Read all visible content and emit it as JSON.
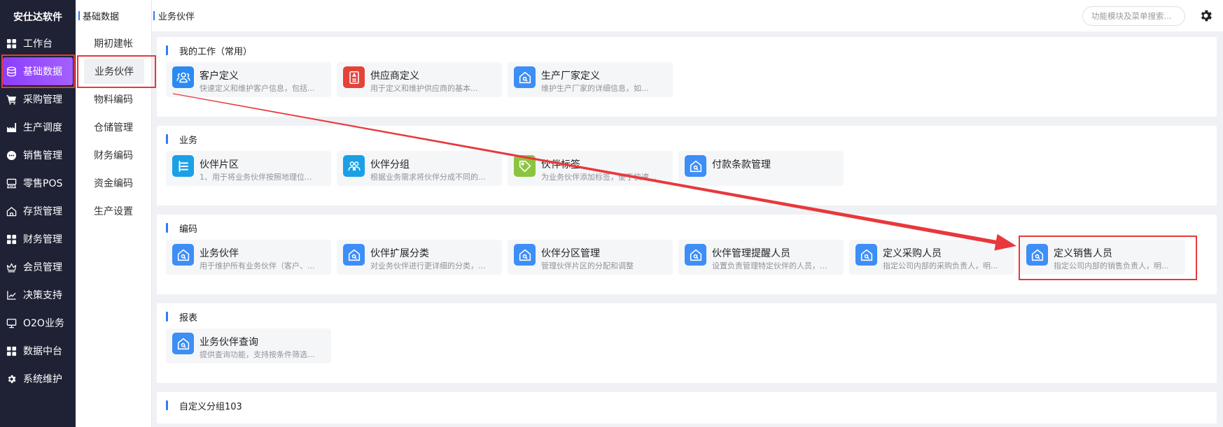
{
  "app": {
    "title": "安仕达软件"
  },
  "sidebar": {
    "items": [
      {
        "label": "工作台",
        "icon": "grid-icon"
      },
      {
        "label": "基础数据",
        "icon": "database-icon",
        "active": true
      },
      {
        "label": "采购管理",
        "icon": "cart-icon"
      },
      {
        "label": "生产调度",
        "icon": "factory-icon"
      },
      {
        "label": "销售管理",
        "icon": "chat-dots-icon"
      },
      {
        "label": "零售POS",
        "icon": "register-icon"
      },
      {
        "label": "存货管理",
        "icon": "warehouse-icon"
      },
      {
        "label": "财务管理",
        "icon": "grid-icon"
      },
      {
        "label": "会员管理",
        "icon": "crown-icon"
      },
      {
        "label": "决策支持",
        "icon": "chart-line-icon"
      },
      {
        "label": "O2O业务",
        "icon": "monitor-icon"
      },
      {
        "label": "数据中台",
        "icon": "grid-icon"
      },
      {
        "label": "系统维护",
        "icon": "gear-icon"
      }
    ]
  },
  "subnav": {
    "title": "基础数据",
    "items": [
      {
        "label": "期初建帐"
      },
      {
        "label": "业务伙伴",
        "active": true
      },
      {
        "label": "物料编码"
      },
      {
        "label": "仓储管理"
      },
      {
        "label": "财务编码"
      },
      {
        "label": "资金编码"
      },
      {
        "label": "生产设置"
      }
    ]
  },
  "header": {
    "breadcrumb": "业务伙伴",
    "search_placeholder": "功能模块及菜单搜索...",
    "settings_icon": "gear-icon"
  },
  "main": {
    "sections": [
      {
        "title": "我的工作（常用）",
        "cards": [
          {
            "title": "客户定义",
            "desc": "快速定义和维护客户信息，包括...",
            "icon": "customer-icon",
            "color": "#2b8af2"
          },
          {
            "title": "供应商定义",
            "desc": "用于定义和维护供应商的基本...",
            "icon": "supplier-icon",
            "color": "#e5433a"
          },
          {
            "title": "生产厂家定义",
            "desc": "维护生产厂家的详细信息，如...",
            "icon": "house-search-icon",
            "color": "#3d8ef6"
          }
        ]
      },
      {
        "title": "业务",
        "cards": [
          {
            "title": "伙伴片区",
            "desc": "1、用于将业务伙伴按照地理位...",
            "icon": "tree-icon",
            "color": "#1aa0e6"
          },
          {
            "title": "伙伴分组",
            "desc": "根据业务需求将伙伴分成不同的...",
            "icon": "group-icon",
            "color": "#1aa0e6"
          },
          {
            "title": "伙伴标签",
            "desc": "为业务伙伴添加标签，便于快速...",
            "icon": "tag-icon",
            "color": "#8bc53f"
          },
          {
            "title": "付款条款管理",
            "icon": "house-search-icon",
            "color": "#3d8ef6"
          }
        ]
      },
      {
        "title": "编码",
        "cards": [
          {
            "title": "业务伙伴",
            "desc": "用于维护所有业务伙伴（客户、...",
            "icon": "house-search-icon",
            "color": "#3d8ef6"
          },
          {
            "title": "伙伴扩展分类",
            "desc": "对业务伙伴进行更详细的分类，...",
            "icon": "house-search-icon",
            "color": "#3d8ef6"
          },
          {
            "title": "伙伴分区管理",
            "desc": "管理伙伴片区的分配和调整",
            "icon": "house-search-icon",
            "color": "#3d8ef6"
          },
          {
            "title": "伙伴管理提醒人员",
            "desc": "设置负责管理特定伙伴的人员，...",
            "icon": "house-search-icon",
            "color": "#3d8ef6"
          },
          {
            "title": "定义采购人员",
            "desc": "指定公司内部的采购负责人，明...",
            "icon": "house-search-icon",
            "color": "#3d8ef6"
          },
          {
            "title": "定义销售人员",
            "desc": "指定公司内部的销售负责人，明...",
            "icon": "house-search-icon",
            "color": "#3d8ef6"
          }
        ]
      },
      {
        "title": "报表",
        "cards": [
          {
            "title": "业务伙伴查询",
            "desc": "提供查询功能，支持按条件筛选...",
            "icon": "house-search-icon",
            "color": "#3d8ef6"
          }
        ]
      },
      {
        "title": "自定义分组103",
        "cards": []
      }
    ]
  },
  "colors": {
    "sidebar_bg": "#1f2235",
    "active_start": "#8b3ffb",
    "active_end": "#a460ff",
    "accent": "#2f7cf6",
    "annotation_red": "#e8383b",
    "page_bg": "#eff1f4"
  }
}
